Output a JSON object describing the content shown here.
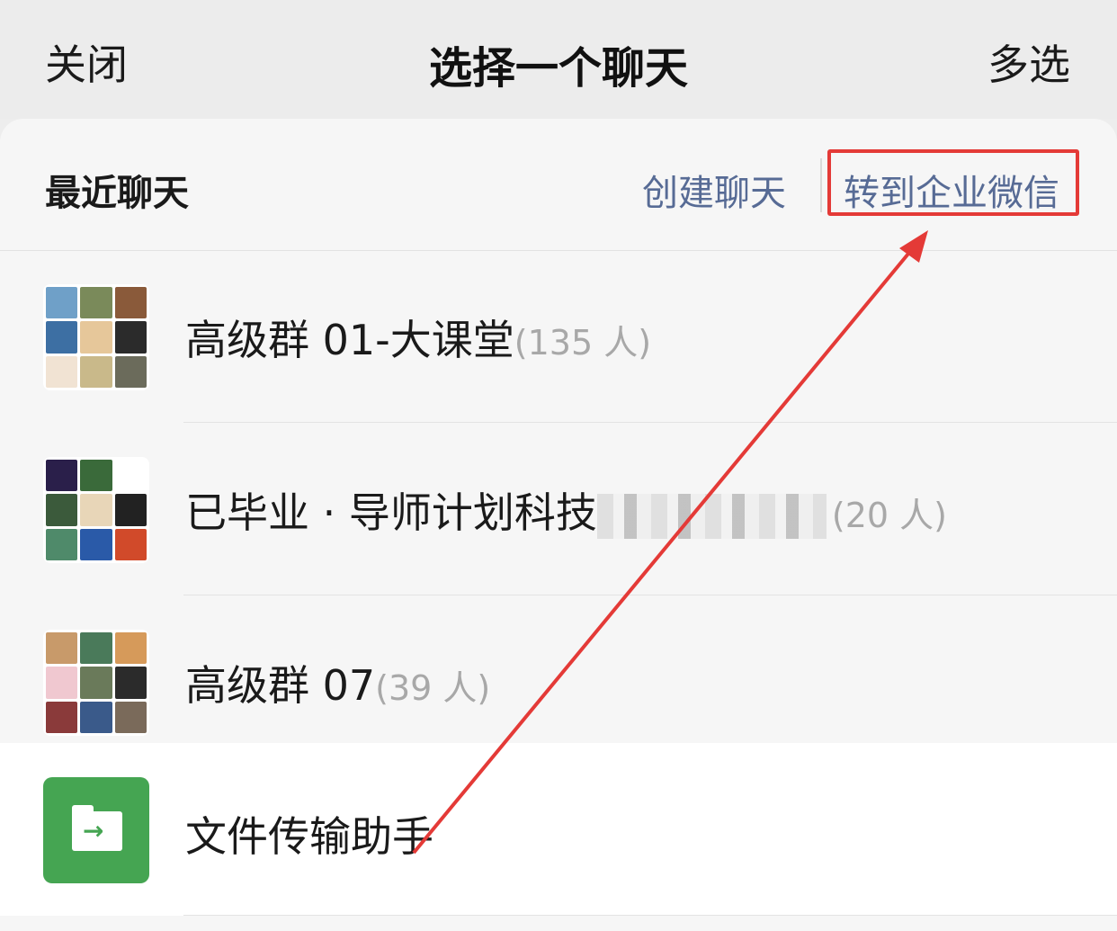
{
  "header": {
    "close_label": "关闭",
    "title": "选择一个聊天",
    "multi_select_label": "多选"
  },
  "section": {
    "recent_label": "最近聊天",
    "create_chat_label": "创建聊天",
    "transfer_label": "转到企业微信"
  },
  "chats": [
    {
      "name": "高级群 01-大课堂",
      "count": "(135 人)"
    },
    {
      "name": "已毕业 · 导师计划科技",
      "count": "(20 人)"
    },
    {
      "name": "高级群 07",
      "count": "(39 人)"
    }
  ],
  "file_helper": {
    "name": "文件传输助手",
    "icon": "file-transfer-icon"
  },
  "colors": {
    "link": "#576b95",
    "annotation": "#e43a37",
    "file_icon_bg": "#45a552"
  }
}
